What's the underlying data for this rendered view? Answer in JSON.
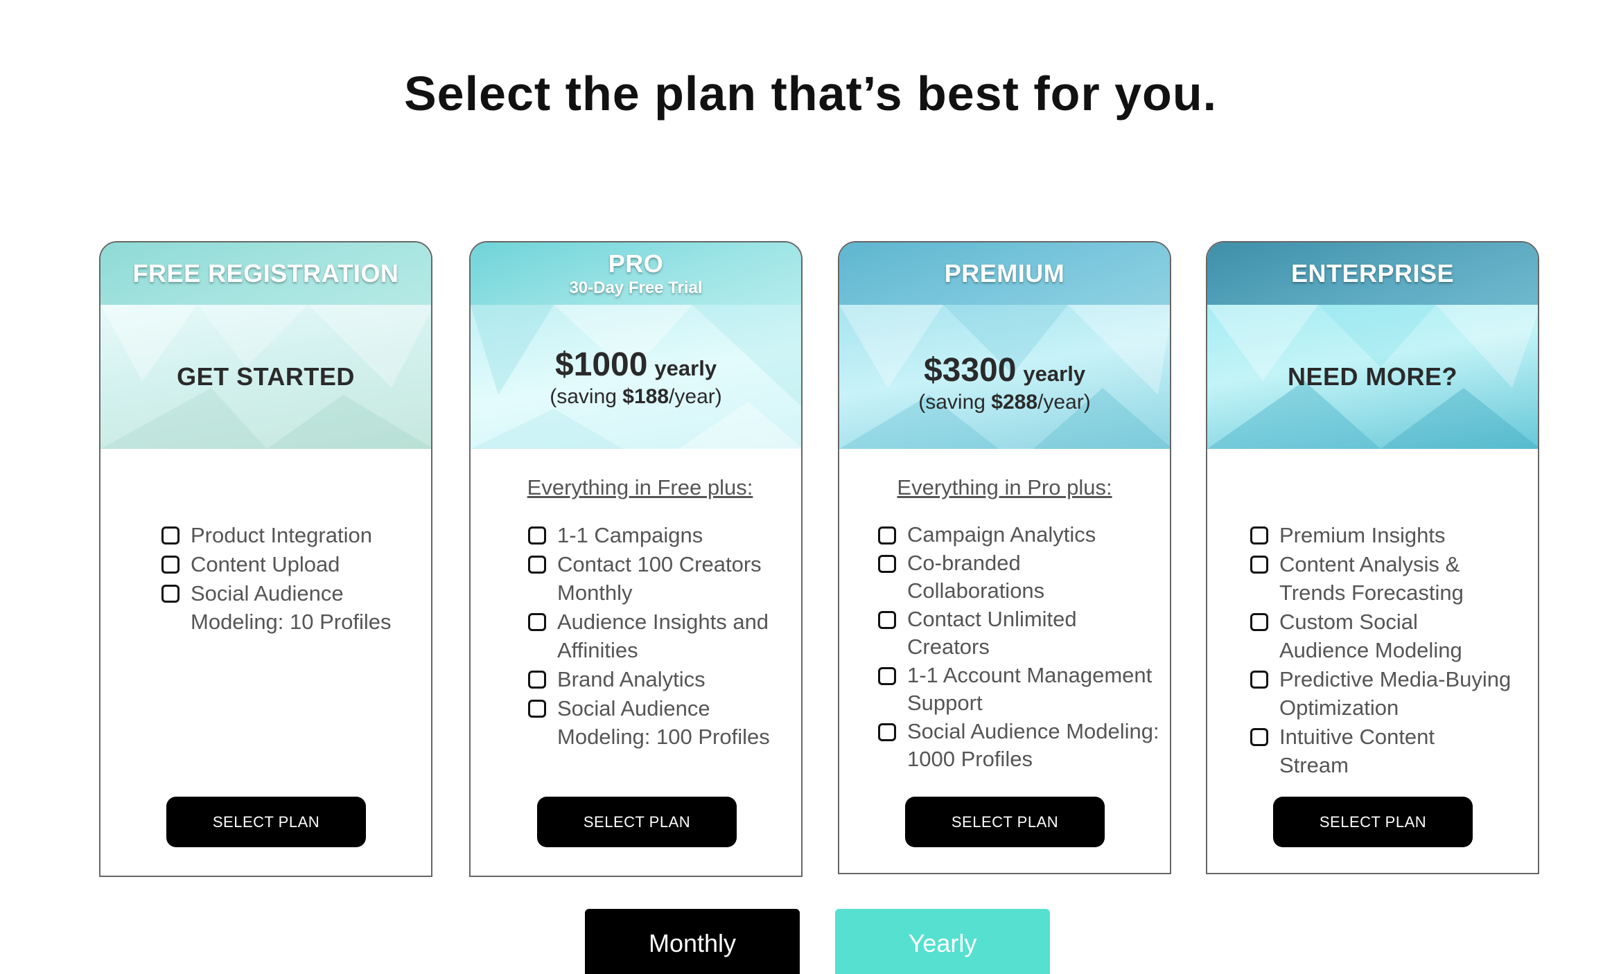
{
  "headline": "Select the plan that’s best for you.",
  "plans": [
    {
      "name": "FREE REGISTRATION",
      "subtitle": "",
      "cta": "GET STARTED",
      "intro": "",
      "features": [
        "Product Integration",
        "Content Upload",
        "Social Audience Modeling: 10 Profiles"
      ],
      "button": "SELECT PLAN"
    },
    {
      "name": "PRO",
      "subtitle": "30-Day Free Trial",
      "price": "$1000",
      "period": "yearly",
      "saving_prefix": "(saving ",
      "saving_amount": "$188",
      "saving_suffix": "/year)",
      "intro": "Everything in Free plus:",
      "features": [
        "1-1 Campaigns",
        "Contact 100 Creators Monthly",
        "Audience Insights and Affinities",
        "Brand Analytics",
        "Social Audience Modeling: 100 Profiles"
      ],
      "button": "SELECT PLAN"
    },
    {
      "name": "PREMIUM",
      "subtitle": "",
      "price": "$3300",
      "period": "yearly",
      "saving_prefix": "(saving ",
      "saving_amount": "$288",
      "saving_suffix": "/year)",
      "intro": "Everything in Pro plus:",
      "features": [
        "Campaign Analytics",
        "Co-branded Collaborations",
        "Contact Unlimited Creators",
        "1-1 Account Management Support",
        "Social Audience Modeling: 1000 Profiles"
      ],
      "button": "SELECT PLAN"
    },
    {
      "name": "ENTERPRISE",
      "subtitle": "",
      "cta": "NEED MORE?",
      "intro": "",
      "features": [
        "Premium Insights",
        "Content Analysis & Trends Forecasting",
        "Custom Social Audience Modeling",
        "Predictive Media-Buying Optimization",
        "Intuitive Content Stream"
      ],
      "button": "SELECT PLAN"
    }
  ],
  "billing_toggle": {
    "monthly": "Monthly",
    "yearly": "Yearly",
    "selected": "Monthly"
  },
  "colors": {
    "accent": "#55e0d0",
    "button": "#000000"
  },
  "icons": {
    "feature_bullet": "checkbox-icon"
  }
}
